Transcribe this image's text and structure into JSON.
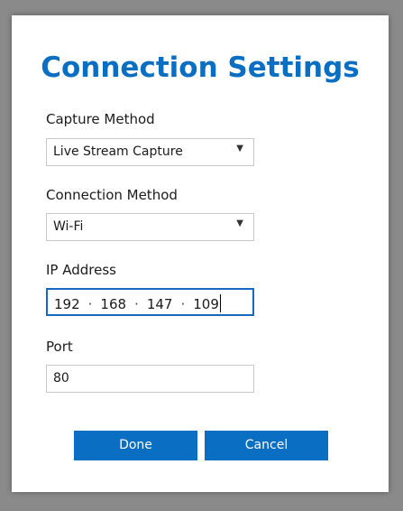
{
  "dialog": {
    "title": "Connection Settings"
  },
  "capture_method": {
    "label": "Capture Method",
    "value": "Live Stream Capture"
  },
  "connection_method": {
    "label": "Connection Method",
    "value": "Wi-Fi"
  },
  "ip_address": {
    "label": "IP Address",
    "octets": [
      "192",
      "168",
      "147",
      "109"
    ],
    "separator": "·"
  },
  "port": {
    "label": "Port",
    "value": "80"
  },
  "buttons": {
    "done": "Done",
    "cancel": "Cancel"
  },
  "icons": {
    "dropdown": "chevron-down-icon"
  },
  "colors": {
    "accent": "#0a6fc2",
    "focus_border": "#1669c0"
  }
}
